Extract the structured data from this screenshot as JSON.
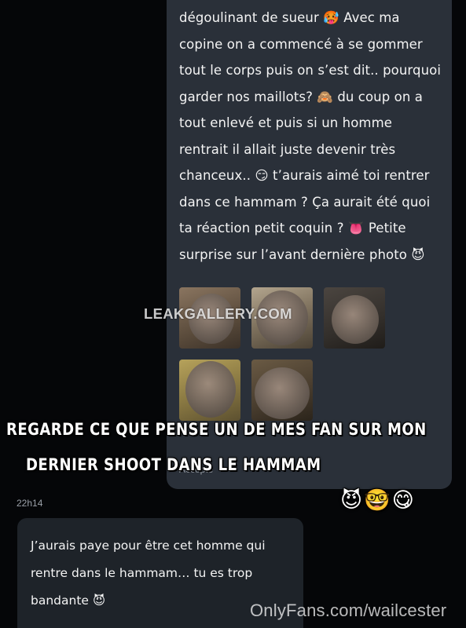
{
  "outgoing_message": {
    "text": "dégoulinant de sueur 🥵 Avec ma copine on a commencé à se gommer tout le corps puis on s’est dit.. pourquoi garder nos maillots? 🙈 du coup on a tout enlevé et puis si un homme rentrait il allait juste devenir très chanceux.. 😏 t’aurais aimé toi rentrer dans ce hammam ? Ça aurait été quoi ta réaction petit coquin ? 👅 Petite surprise sur l’avant dernière photo 😈",
    "status": "Accepté"
  },
  "timestamp": "22h14",
  "incoming_message": {
    "text": "J’aurais paye pour être cet homme qui rentre dans le hammam… tu es trop bandante 😈"
  },
  "caption": {
    "line1": "REGARDE CE QUE PENSE UN DE MES FAN SUR MON",
    "line2": "DERNIER SHOOT DANS LE HAMMAM",
    "emojis": "😈🤓😋"
  },
  "watermarks": {
    "leakgallery": "LEAKGALLERY.COM",
    "onlyfans": "OnlyFans.com/wailcester"
  },
  "colors": {
    "background": "#050608",
    "outgoing_bubble": "#2a3039",
    "incoming_bubble": "#1e2329",
    "text": "#f4f4f4",
    "muted": "#9aa0a8"
  }
}
